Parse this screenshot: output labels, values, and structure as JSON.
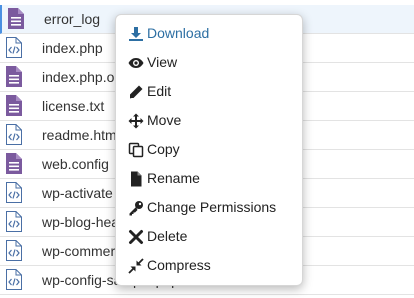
{
  "files": [
    {
      "name": "error_log",
      "icon": "text-file-icon"
    },
    {
      "name": "index.php",
      "icon": "code-file-icon"
    },
    {
      "name": "index.php.o",
      "icon": "text-file-icon"
    },
    {
      "name": "license.txt",
      "icon": "text-file-icon"
    },
    {
      "name": "readme.htm",
      "icon": "code-file-icon"
    },
    {
      "name": "web.config",
      "icon": "text-file-icon"
    },
    {
      "name": "wp-activate",
      "icon": "code-file-icon"
    },
    {
      "name": "wp-blog-hea",
      "icon": "code-file-icon"
    },
    {
      "name": "wp-commer",
      "icon": "code-file-icon"
    },
    {
      "name": "wp-config-sample.php",
      "icon": "code-file-icon"
    }
  ],
  "context_menu": {
    "items": [
      {
        "label": "Download",
        "icon": "download-icon"
      },
      {
        "label": "View",
        "icon": "eye-icon"
      },
      {
        "label": "Edit",
        "icon": "pencil-icon"
      },
      {
        "label": "Move",
        "icon": "move-arrows-icon"
      },
      {
        "label": "Copy",
        "icon": "copy-icon"
      },
      {
        "label": "Rename",
        "icon": "file-icon"
      },
      {
        "label": "Change Permissions",
        "icon": "key-icon"
      },
      {
        "label": "Delete",
        "icon": "close-x-icon"
      },
      {
        "label": "Compress",
        "icon": "compress-icon"
      }
    ]
  },
  "colors": {
    "text_file_icon": "#7b5a9e",
    "code_file_icon": "#4a6fa5",
    "download_accent": "#2d6fa3"
  }
}
